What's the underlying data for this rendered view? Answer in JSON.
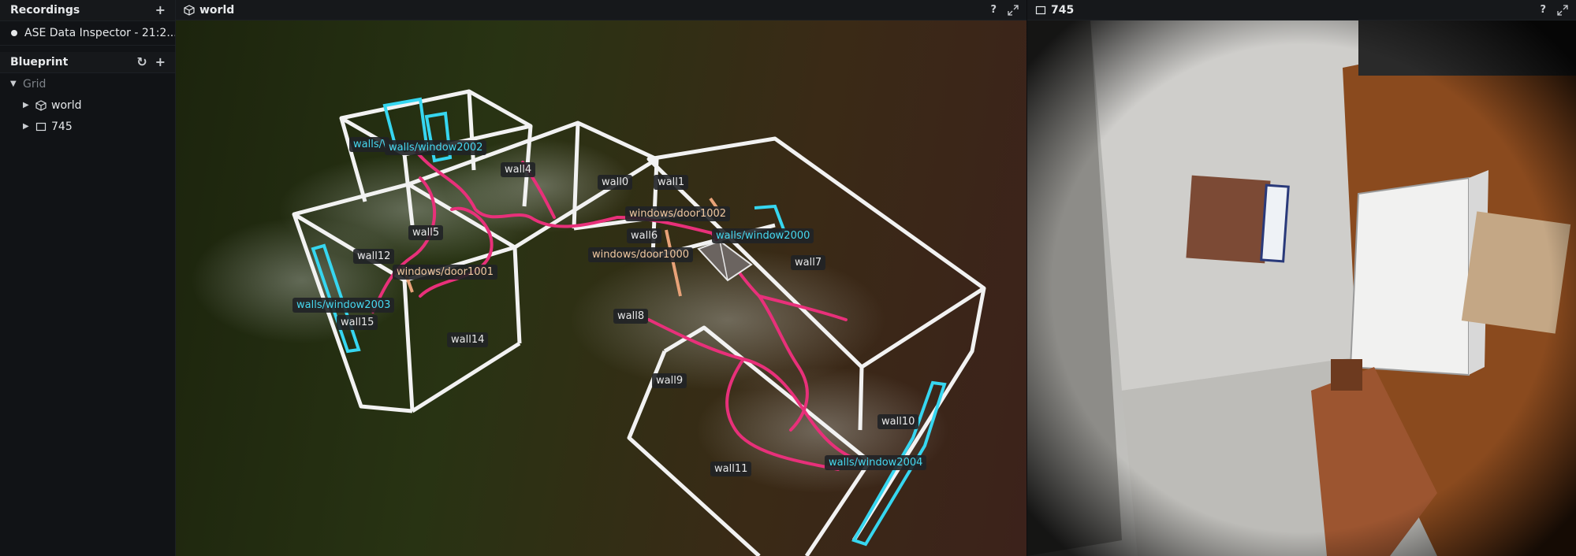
{
  "recordings": {
    "title": "Recordings",
    "add_label": "+",
    "item_label": "ASE Data Inspector - 21:2..."
  },
  "blueprint": {
    "title": "Blueprint",
    "reset_label": "↻",
    "add_label": "+",
    "tree": {
      "root_label": "Grid",
      "children": [
        {
          "label": "world",
          "icon": "cube-icon"
        },
        {
          "label": "745",
          "icon": "square-icon"
        }
      ]
    }
  },
  "views": {
    "world": {
      "title": "world",
      "help_label": "?",
      "labels": {
        "wall0": "wall0",
        "wall1": "wall1",
        "wall4": "wall4",
        "wall5": "wall5",
        "wall6": "wall6",
        "wall7": "wall7",
        "wall8": "wall8",
        "wall9": "wall9",
        "wall10": "wall10",
        "wall11": "wall11",
        "wall12": "wall12",
        "wall14": "wall14",
        "wall15": "wall15",
        "walls_w_partial": "walls/\\",
        "walls_window2002": "walls/window2002",
        "walls_window2000": "walls/window2000",
        "walls_window2003": "walls/window2003",
        "walls_window2004": "walls/window2004",
        "windows_door1002": "windows/door1002",
        "windows_door1000": "windows/door1000",
        "windows_door1001": "windows/door1001"
      }
    },
    "image": {
      "title": "745",
      "help_label": "?"
    }
  },
  "colors": {
    "wireframe": "#ffffff",
    "trajectory": "#e8307a",
    "windows": "#36d6f0",
    "doors": "#e8a278"
  }
}
